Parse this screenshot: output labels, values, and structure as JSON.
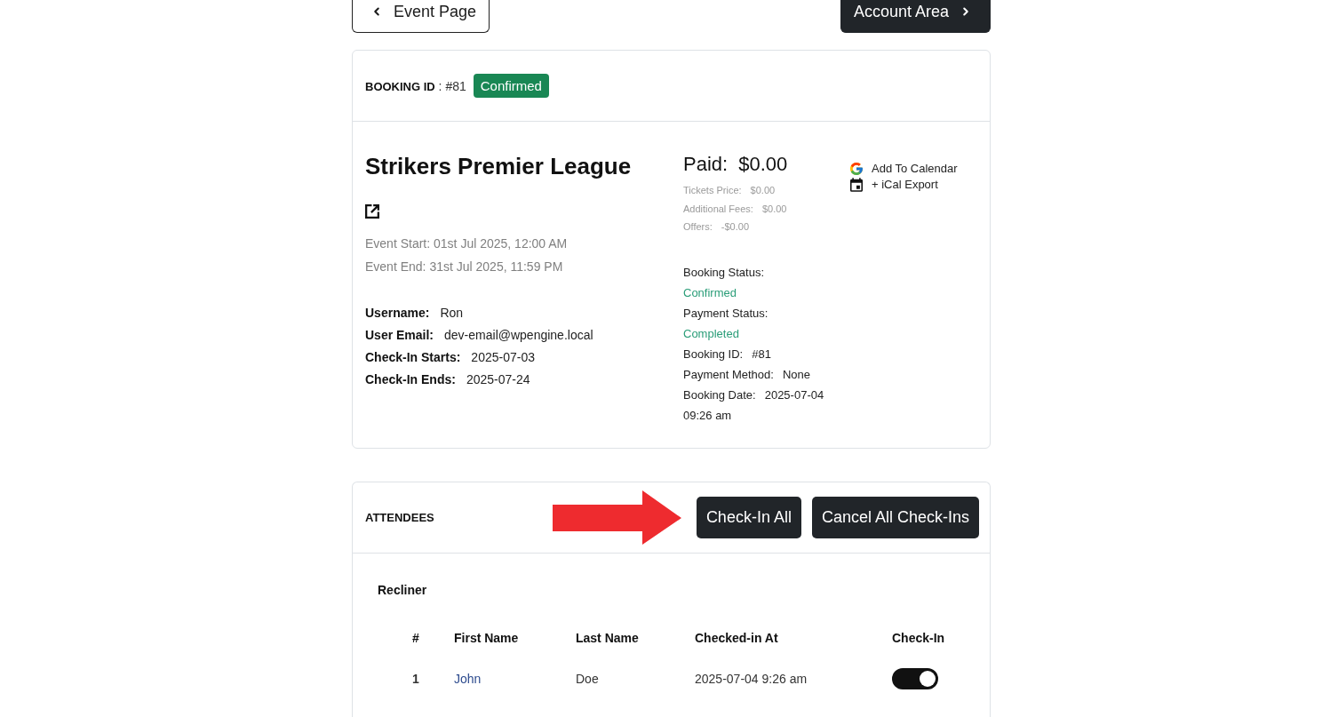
{
  "top_nav": {
    "back_button": "Event Page",
    "forward_button": "Account Area"
  },
  "booking": {
    "header": "**BOOKING ID** : #81",
    "status_badge": "Confirmed",
    "event": {
      "title": "Strikers Premier League",
      "start": "Event Start: 01st Jul 2025, 12:00 AM",
      "end": "Event End: 31st Jul 2025, 11:59 PM"
    },
    "user_details": [
      {
        "label": "Username:",
        "value": "Ron"
      },
      {
        "label": "User Email:",
        "value": "dev-email@wpengine.local"
      },
      {
        "label": "Check-In Starts:",
        "value": "2025-07-03"
      },
      {
        "label": "Check-In Ends:",
        "value": "2025-07-24"
      }
    ],
    "payment": {
      "paid_label": "Paid:",
      "paid_amount": "$0.00",
      "breakdown": [
        {
          "label": "Tickets Price:",
          "value": "$0.00"
        },
        {
          "label": "Additional Fees:",
          "value": "$0.00"
        },
        {
          "label": "Offers:",
          "value": "-$0.00"
        }
      ]
    },
    "status_details": [
      {
        "kind": "status",
        "label": "Booking Status:",
        "value": "Confirmed"
      },
      {
        "kind": "status",
        "label": "Payment Status:",
        "value": "Completed"
      },
      {
        "kind": "plain",
        "label": "Booking ID:",
        "value": "#81"
      },
      {
        "kind": "plain",
        "label": "Payment Method:",
        "value": "None"
      },
      {
        "kind": "plain",
        "label": "Booking Date:",
        "value": "2025-07-04 09:26 am"
      }
    ],
    "calendar_links": [
      {
        "kind": "google",
        "label": "Add To Calendar"
      },
      {
        "kind": "ical",
        "label": "+ iCal Export"
      }
    ]
  },
  "attendees": {
    "title": "ATTENDEES",
    "actions": [
      "Check-In All",
      "Cancel All Check-Ins"
    ],
    "groups": [
      {
        "name": "Recliner",
        "columns": [
          "#",
          "First Name",
          "Last Name",
          "Checked-in At",
          "Check-In"
        ],
        "rows": [
          {
            "cells": [
              "1",
              "John",
              "Doe",
              "2025-07-04 9:26 am"
            ],
            "checked_in": true
          }
        ]
      }
    ]
  }
}
